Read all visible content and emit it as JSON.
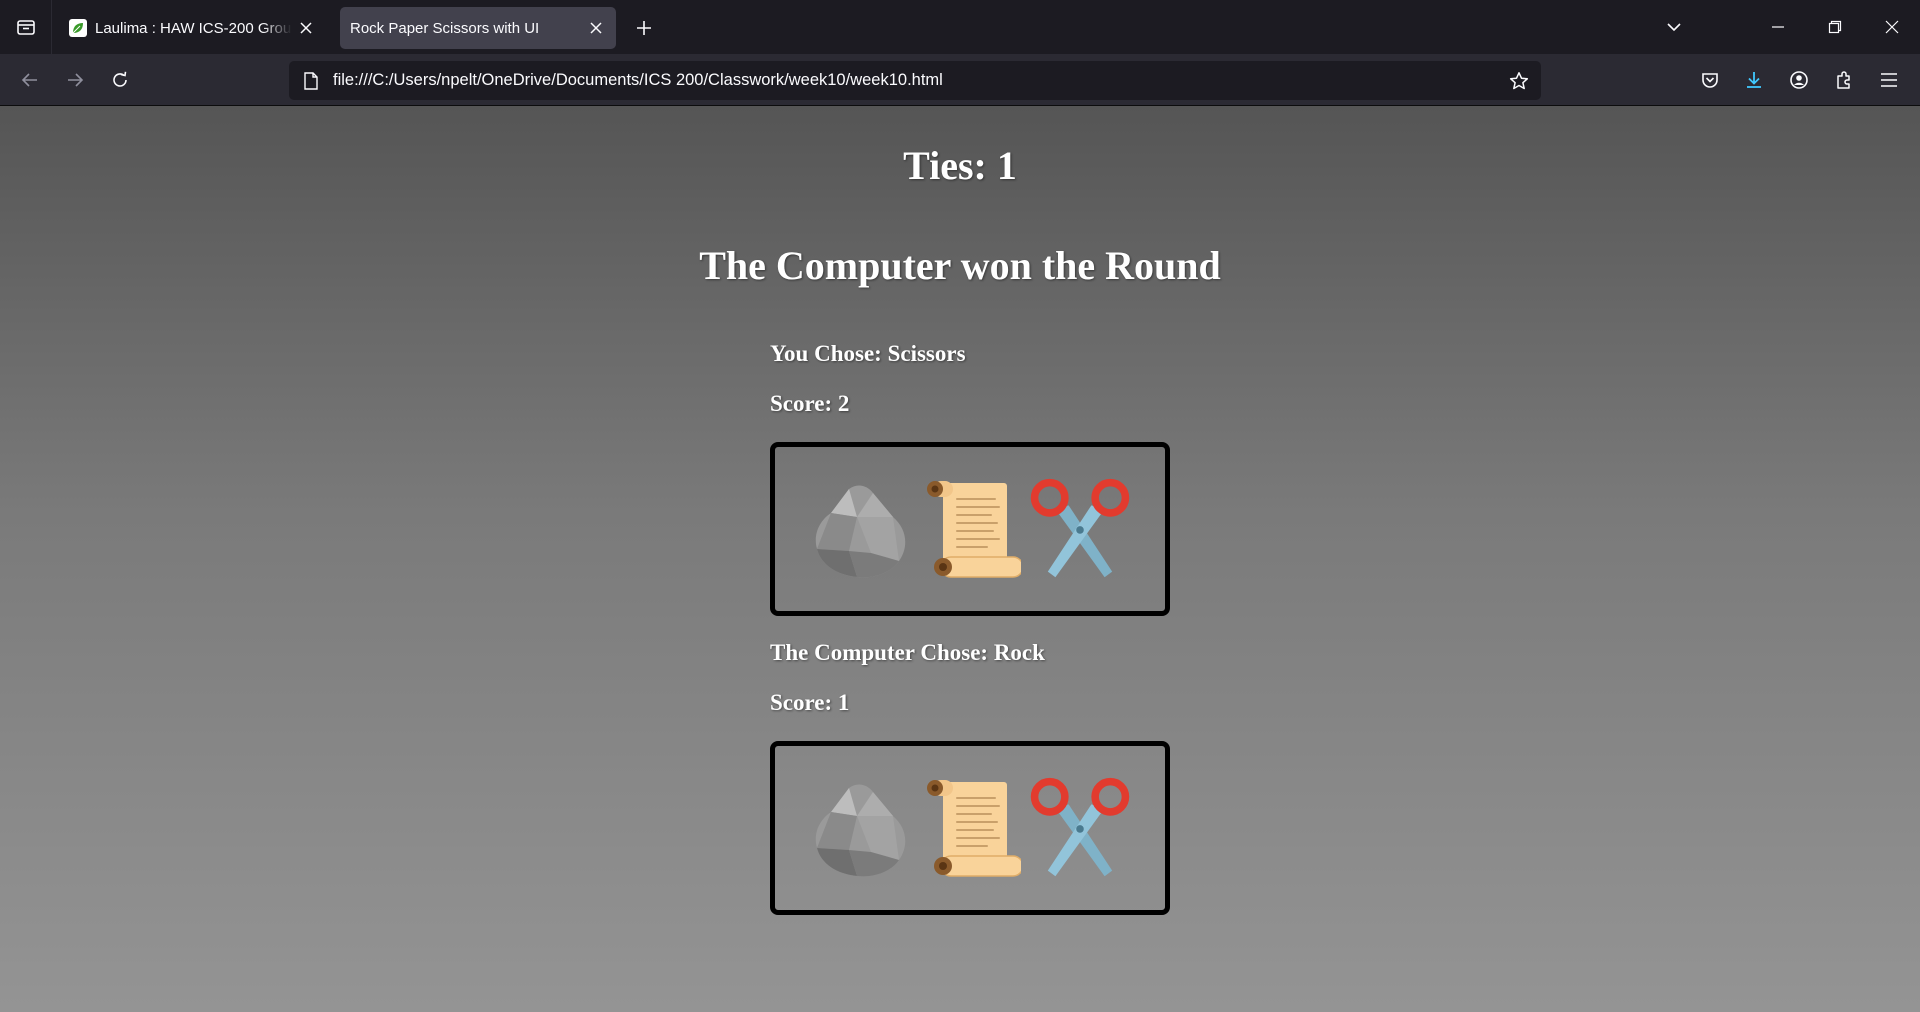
{
  "browser": {
    "tabs": [
      {
        "title": "Laulima : HAW ICS-200 Group [",
        "active": false,
        "favicon": "laulima-leaf-icon"
      },
      {
        "title": "Rock Paper Scissors with UI",
        "active": true
      }
    ],
    "url": "file:///C:/Users/npelt/OneDrive/Documents/ICS 200/Classwork/week10/week10.html"
  },
  "game": {
    "ties": "Ties: 1",
    "round_result": "The Computer won the Round",
    "player": {
      "chose": "You Chose: Scissors",
      "score": "Score: 2"
    },
    "computer": {
      "chose": "The Computer Chose: Rock",
      "score": "Score: 1"
    },
    "choices": [
      "rock-icon",
      "scroll-icon",
      "scissors-icon"
    ]
  },
  "colors": {
    "chrome_bg": "#1c1b22",
    "toolbar_bg": "#2b2a33",
    "active_tab": "#42414d",
    "download_accent": "#40c9ff",
    "page_gradient_top": "#555555",
    "page_gradient_bottom": "#949494"
  }
}
